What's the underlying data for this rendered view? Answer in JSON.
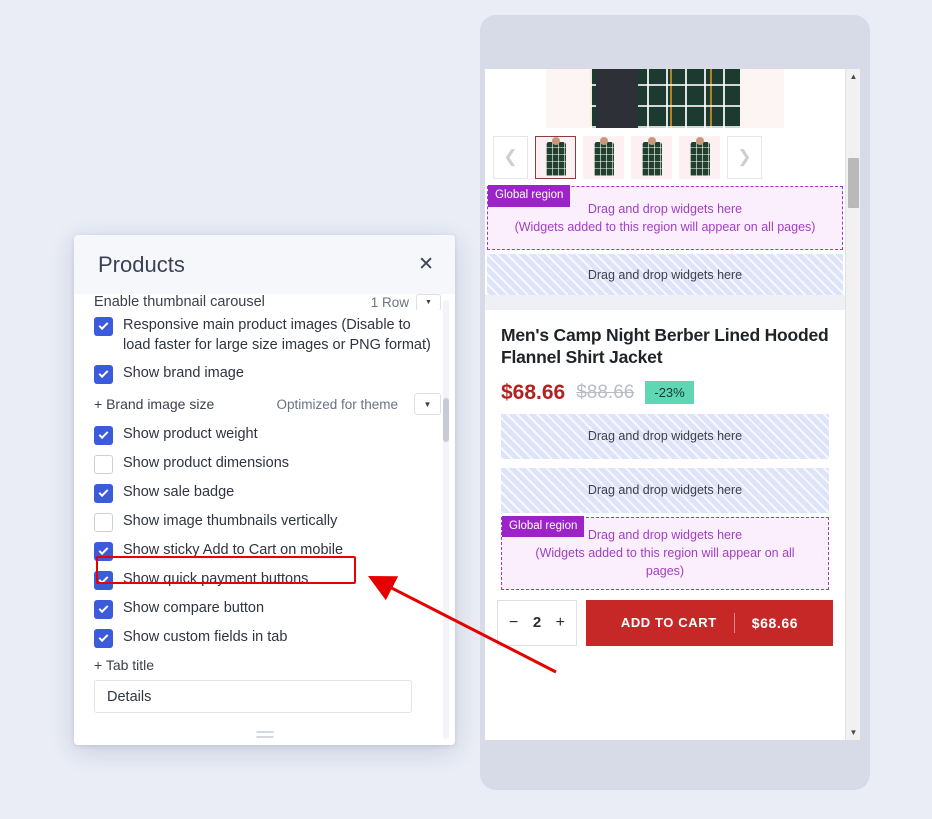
{
  "modal": {
    "title": "Products",
    "close_icon": "close-icon",
    "clipped_setting": {
      "label": "Enable thumbnail carousel",
      "value": "1 Row",
      "caret_icon": "chevron-down-icon"
    },
    "checkboxes": [
      {
        "label": "Responsive main product images (Disable to load faster for large size images or PNG format)",
        "checked": true
      },
      {
        "label": "Show brand image",
        "checked": true
      }
    ],
    "brand_image_size": {
      "label": "+ Brand image size",
      "value": "Optimized for theme",
      "caret_icon": "chevron-down-icon"
    },
    "checkboxes2": [
      {
        "label": "Show product weight",
        "checked": true
      },
      {
        "label": "Show product dimensions",
        "checked": false
      },
      {
        "label": "Show sale badge",
        "checked": true
      },
      {
        "label": "Show image thumbnails vertically",
        "checked": false
      },
      {
        "label": "Show sticky Add to Cart on mobile",
        "checked": true,
        "highlighted": true
      },
      {
        "label": "Show quick payment buttons",
        "checked": true
      },
      {
        "label": "Show compare button",
        "checked": true
      },
      {
        "label": "Show custom fields in tab",
        "checked": true
      }
    ],
    "tab_title": {
      "label": "+ Tab title",
      "value": "Details",
      "placeholder": "Tab title"
    }
  },
  "preview": {
    "carousel": {
      "prev_icon": "chevron-left-icon",
      "next_icon": "chevron-right-icon",
      "thumbnails": [
        {
          "alt": "jacket-thumbnail-1",
          "selected": true
        },
        {
          "alt": "jacket-thumbnail-2",
          "selected": false
        },
        {
          "alt": "jacket-thumbnail-3",
          "selected": false
        },
        {
          "alt": "jacket-thumbnail-4",
          "selected": false
        }
      ]
    },
    "global_region_top": {
      "badge": "Global region",
      "line1": "Drag and drop widgets here",
      "line2": "(Widgets added to this region will appear on all pages)"
    },
    "dropzone_top": "Drag and drop widgets here",
    "product": {
      "title": "Men's Camp Night Berber Lined Hooded Flannel Shirt Jacket",
      "price": "$68.66",
      "compare_price": "$88.66",
      "discount_badge": "-23%"
    },
    "dropzone_mid_1": "Drag and drop widgets here",
    "dropzone_mid_2": "Drag and drop widgets here",
    "global_region_bottom": {
      "badge": "Global region",
      "line1": "Drag and drop widgets here",
      "line2": "(Widgets added to this region will appear on all",
      "line3": "pages)"
    },
    "sticky_cart": {
      "minus": "−",
      "quantity": "2",
      "plus": "+",
      "add_to_cart_label": "ADD TO CART",
      "price": "$68.66"
    },
    "scrollbar": {
      "up_icon": "scroll-up-arrow-icon",
      "down_icon": "scroll-down-arrow-icon"
    }
  },
  "colors": {
    "checkbox_blue": "#3b5bdb",
    "highlight_red": "#e60000",
    "cart_red": "#c62828",
    "price_red": "#b32121",
    "sale_badge_teal": "#5fd6b4",
    "global_region_purple": "#9b23c7",
    "dropzone_blue": "#dde3f8",
    "page_background": "#eaedf6",
    "device_frame": "#d7dbe8"
  }
}
